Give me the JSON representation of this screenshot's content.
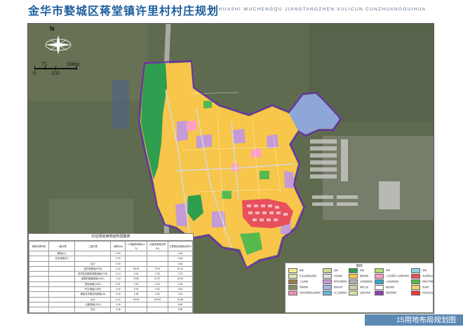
{
  "header": {
    "title": "金华市婺城区蒋堂镇许里村村庄规划",
    "subtitle": "JINHUASHI WUCHENGQU JIANGTANGZHEN XULICUN CUNZHUANGGUIHUA"
  },
  "footer": {
    "sheet_title": "15用地布局规划图"
  },
  "north_arrow": {
    "label": "N",
    "icon": "compass-rose-icon"
  },
  "scale_bar": {
    "ticks": [
      "75",
      "300m",
      "0",
      "150"
    ]
  },
  "land_use_table": {
    "title": "村庄规划用地结构调整表",
    "headers": [
      "用地分类代码",
      "一级分类",
      "二级分类",
      "面积(ha)",
      "人均建设用地(m²/人)",
      "占建设用地比例(%)",
      "占规划区用地比例(%)"
    ],
    "rows": [
      [
        "",
        "耕地(01)",
        "",
        "0.03",
        "",
        "",
        "0.46"
      ],
      [
        "",
        "农业设施(07)",
        "",
        "0.03",
        "",
        "",
        "0.46"
      ],
      [
        "",
        "",
        "合计",
        "0.03",
        "",
        "",
        "0.46"
      ],
      [
        "",
        "",
        "农村宅基地(0703)",
        "4.43",
        "65.34",
        "72.67",
        "67.22"
      ],
      [
        "",
        "",
        "农村社区服务设施用地(0704)",
        "0.14",
        "2.06",
        "2.30",
        "2.13"
      ],
      [
        "",
        "",
        "城镇村道路用地(1201)",
        "1.34",
        "19.80",
        "21.97",
        "20.34"
      ],
      [
        "",
        "",
        "供电用地(1303)",
        "0.01",
        "0.15",
        "0.16",
        "0.15"
      ],
      [
        "",
        "",
        "环卫用地(1309)",
        "0.02",
        "0.29",
        "0.33",
        "0.30"
      ],
      [
        "",
        "",
        "绿地与开敞空间用地(14)",
        "0.16",
        "2.36",
        "2.62",
        "2.43"
      ],
      [
        "",
        "",
        "合计",
        "6.10",
        "90.00",
        "100.00",
        "92.56"
      ],
      [
        "",
        "",
        "公路用地(1202)",
        "0.46",
        "",
        "",
        "6.98"
      ],
      [
        "",
        "",
        "合计",
        "0.46",
        "",
        "",
        "6.98"
      ],
      [
        "",
        "",
        "总计",
        "6.59",
        "",
        "",
        "100.00"
      ]
    ]
  },
  "legend": {
    "title": "图例",
    "items": [
      {
        "label": "耕地",
        "color": "#f5e890"
      },
      {
        "label": "园地",
        "color": "#c8e08a"
      },
      {
        "label": "林地",
        "color": "#2e9e4f"
      },
      {
        "label": "草地",
        "color": "#b7d979"
      },
      {
        "label": "湿地",
        "color": "#8fd3e0"
      },
      {
        "label": "农业设施建设用地",
        "color": "#d6e6b0"
      },
      {
        "label": "村道用地",
        "color": "#e0e0e0"
      },
      {
        "label": "居住用地",
        "color": "#f7c64a"
      },
      {
        "label": "公共管理与公共服务用地",
        "color": "#ff9ec6"
      },
      {
        "label": "商业服务业用地",
        "color": "#e8505b"
      },
      {
        "label": "工业用地",
        "color": "#a07850"
      },
      {
        "label": "物流仓储用地",
        "color": "#c49bd6"
      },
      {
        "label": "交通运输用地",
        "color": "#b0b0b0"
      },
      {
        "label": "公用设施用地",
        "color": "#3aa3c8"
      },
      {
        "label": "绿地与开敞空间用地",
        "color": "#56b94e"
      },
      {
        "label": "特殊用地",
        "color": "#7f8f60"
      },
      {
        "label": "陆地水域",
        "color": "#9fb8e6"
      },
      {
        "label": "其他土地",
        "color": "#d7c9a8"
      },
      {
        "label": "留白用地",
        "color": "#ffffff"
      },
      {
        "label": "宅基地",
        "color": "#f2d06b"
      },
      {
        "label": "农村社区服务设施用地",
        "color": "#ef8fb0"
      },
      {
        "label": "水工设施用地",
        "color": "#66b5d6"
      },
      {
        "label": "设施农用地",
        "color": "#cde6a2"
      },
      {
        "label": "规划范围线",
        "color": "#8b3fb0"
      },
      {
        "label": "村庄建设边界",
        "color": "#e63939"
      }
    ]
  },
  "map": {
    "colors": {
      "residential": "#f7c64a",
      "forest": "#2e9e4f",
      "commercial": "#e8505b",
      "lilac": "#c49bd6",
      "water": "#8ea6d8",
      "boundary": "#6a2fb0",
      "road": "#c8c8c8",
      "satellite": "#5c6a4c"
    }
  }
}
